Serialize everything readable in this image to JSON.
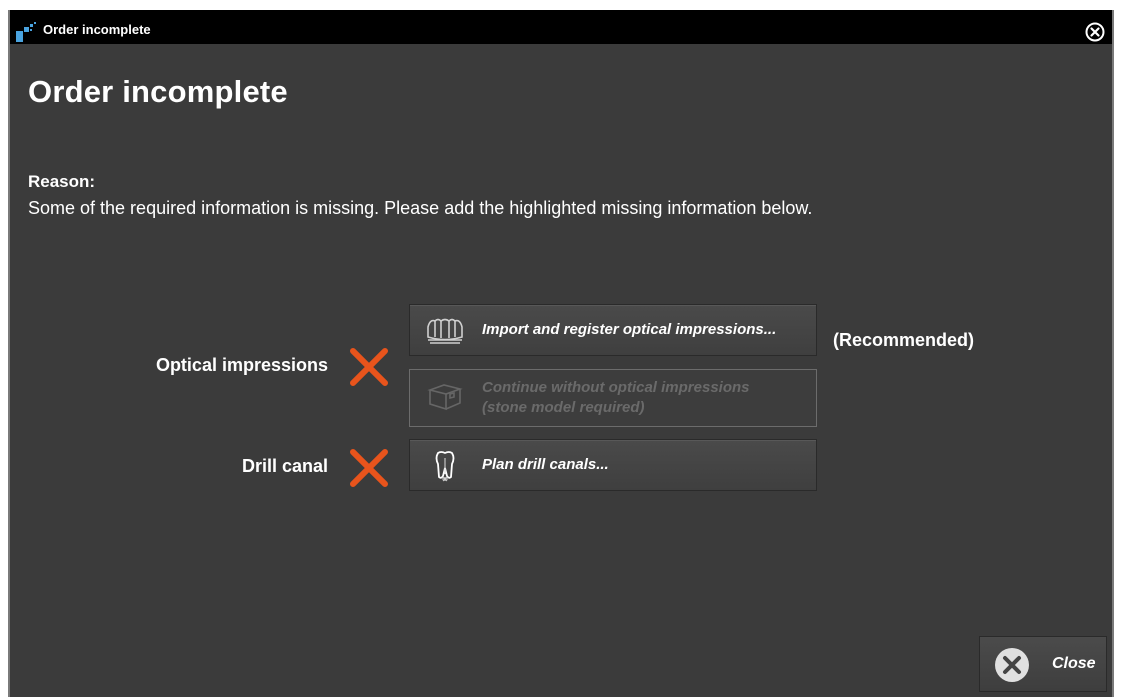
{
  "window": {
    "title": "Order incomplete"
  },
  "heading": "Order incomplete",
  "reason": {
    "label": "Reason:",
    "text": "Some of the required information is missing. Please add the highlighted missing information below."
  },
  "requirements": [
    {
      "label": "Optical impressions",
      "status": "missing",
      "status_icon": "x-mark-icon",
      "status_color": "#e8541c",
      "actions": [
        {
          "label": "Import and register optical impressions...",
          "icon": "dental-arch-icon",
          "enabled": true,
          "note": "(Recommended)"
        },
        {
          "label_line1": "Continue without optical impressions",
          "label_line2": "(stone model required)",
          "icon": "stone-model-box-icon",
          "enabled": false
        }
      ]
    },
    {
      "label": "Drill canal",
      "status": "missing",
      "status_icon": "x-mark-icon",
      "status_color": "#e8541c",
      "actions": [
        {
          "label": "Plan drill canals...",
          "icon": "tooth-drill-icon",
          "enabled": true
        }
      ]
    }
  ],
  "footer": {
    "close_label": "Close",
    "close_icon": "close-circle-icon"
  },
  "colors": {
    "background": "#3b3b3b",
    "titlebar": "#000000",
    "accent_missing": "#e8541c",
    "text": "#ffffff",
    "disabled_text": "#6a6a6a"
  }
}
